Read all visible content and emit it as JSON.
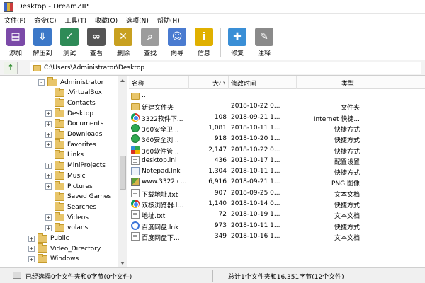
{
  "window": {
    "title": "Desktop - DreamZIP"
  },
  "menu": [
    "文件(F)",
    "命令(C)",
    "工具(T)",
    "收藏(O)",
    "选项(N)",
    "帮助(H)"
  ],
  "toolbar": {
    "buttons": [
      {
        "label": "添加",
        "icon": "add-archive-icon",
        "color": "#7b4aa8",
        "glyph": "▤"
      },
      {
        "label": "解压到",
        "icon": "extract-icon",
        "color": "#3c78c8",
        "glyph": "⇩"
      },
      {
        "label": "测试",
        "icon": "test-icon",
        "color": "#2e8b57",
        "glyph": "✓"
      },
      {
        "label": "查看",
        "icon": "view-icon",
        "color": "#555555",
        "glyph": "∞"
      },
      {
        "label": "删除",
        "icon": "delete-icon",
        "color": "#c8a020",
        "glyph": "✕"
      },
      {
        "label": "查找",
        "icon": "find-icon",
        "color": "#9c9c9c",
        "glyph": "⌕"
      },
      {
        "label": "向导",
        "icon": "wizard-icon",
        "color": "#4a7bd0",
        "glyph": "☺"
      },
      {
        "label": "信息",
        "icon": "info-icon",
        "color": "#e0b000",
        "glyph": "i"
      },
      {
        "label": "修复",
        "icon": "repair-icon",
        "color": "#3a8fd6",
        "glyph": "✚"
      },
      {
        "label": "注释",
        "icon": "comment-icon",
        "color": "#8a8a8a",
        "glyph": "✎"
      }
    ]
  },
  "address": {
    "path": "C:\\Users\\Administrator\\Desktop"
  },
  "tree": [
    {
      "label": "Administrator",
      "level": 0,
      "expander": "−"
    },
    {
      "label": ".VirtualBox",
      "level": 1,
      "expander": ""
    },
    {
      "label": "Contacts",
      "level": 1,
      "expander": ""
    },
    {
      "label": "Desktop",
      "level": 1,
      "expander": "+"
    },
    {
      "label": "Documents",
      "level": 1,
      "expander": "+"
    },
    {
      "label": "Downloads",
      "level": 1,
      "expander": "+"
    },
    {
      "label": "Favorites",
      "level": 1,
      "expander": "+"
    },
    {
      "label": "Links",
      "level": 1,
      "expander": ""
    },
    {
      "label": "MiniProjects",
      "level": 1,
      "expander": "+"
    },
    {
      "label": "Music",
      "level": 1,
      "expander": "+"
    },
    {
      "label": "Pictures",
      "level": 1,
      "expander": "+"
    },
    {
      "label": "Saved Games",
      "level": 1,
      "expander": ""
    },
    {
      "label": "Searches",
      "level": 1,
      "expander": ""
    },
    {
      "label": "Videos",
      "level": 1,
      "expander": "+"
    },
    {
      "label": "volans",
      "level": 1,
      "expander": "+"
    },
    {
      "label": "Public",
      "level": -1,
      "expander": "+"
    },
    {
      "label": "Video_Directory",
      "level": -2,
      "expander": "+"
    },
    {
      "label": "Windows",
      "level": -2,
      "expander": "+"
    }
  ],
  "columns": {
    "name": "名称",
    "size": "大小",
    "date": "修改时间",
    "type": "类型"
  },
  "files": [
    {
      "name": "..",
      "size": "",
      "date": "",
      "type": "",
      "icon": "folder-icon",
      "cls": "ic-folder"
    },
    {
      "name": "新建文件夹",
      "size": "",
      "date": "2018-10-22 0...",
      "type": "文件夹",
      "icon": "folder-icon",
      "cls": "ic-folder"
    },
    {
      "name": "3322软件下...",
      "size": "108",
      "date": "2018-09-21 1...",
      "type": "Internet 快捷...",
      "icon": "chrome-icon",
      "cls": "ic-chrome"
    },
    {
      "name": "360安全卫...",
      "size": "1,081",
      "date": "2018-10-11 1...",
      "type": "快捷方式",
      "icon": "360-safe-icon",
      "cls": "ic-360"
    },
    {
      "name": "360安全浏...",
      "size": "918",
      "date": "2018-10-20 1...",
      "type": "快捷方式",
      "icon": "360-browser-icon",
      "cls": "ic-360"
    },
    {
      "name": "360软件管...",
      "size": "2,147",
      "date": "2018-10-22 0...",
      "type": "快捷方式",
      "icon": "360-manager-icon",
      "cls": "ic-360c"
    },
    {
      "name": "desktop.ini",
      "size": "436",
      "date": "2018-10-17 1...",
      "type": "配置设置",
      "icon": "settings-file-icon",
      "cls": "ic-file"
    },
    {
      "name": "Notepad.lnk",
      "size": "1,304",
      "date": "2018-10-11 1...",
      "type": "快捷方式",
      "icon": "shortcut-icon",
      "cls": "ic-lnk"
    },
    {
      "name": "www.3322.c...",
      "size": "6,916",
      "date": "2018-09-21 1...",
      "type": "PNG 图像",
      "icon": "png-image-icon",
      "cls": "ic-png"
    },
    {
      "name": "下载地址.txt",
      "size": "907",
      "date": "2018-09-25 0...",
      "type": "文本文档",
      "icon": "text-file-icon",
      "cls": "ic-file"
    },
    {
      "name": "双核浏览器.l...",
      "size": "1,140",
      "date": "2018-10-14 0...",
      "type": "快捷方式",
      "icon": "chrome-icon",
      "cls": "ic-chrome"
    },
    {
      "name": "地址.txt",
      "size": "72",
      "date": "2018-10-19 1...",
      "type": "文本文档",
      "icon": "text-file-icon",
      "cls": "ic-file"
    },
    {
      "name": "百度网盘.lnk",
      "size": "973",
      "date": "2018-10-11 1...",
      "type": "快捷方式",
      "icon": "baidu-netdisk-icon",
      "cls": "ic-baidu"
    },
    {
      "name": "百度网盘下...",
      "size": "349",
      "date": "2018-10-16 1...",
      "type": "文本文档",
      "icon": "text-file-icon",
      "cls": "ic-file"
    }
  ],
  "status": {
    "left": "已经选择0个文件夹和0字节(0个文件)",
    "right": "总计1个文件夹和16,351字节(12个文件)"
  }
}
